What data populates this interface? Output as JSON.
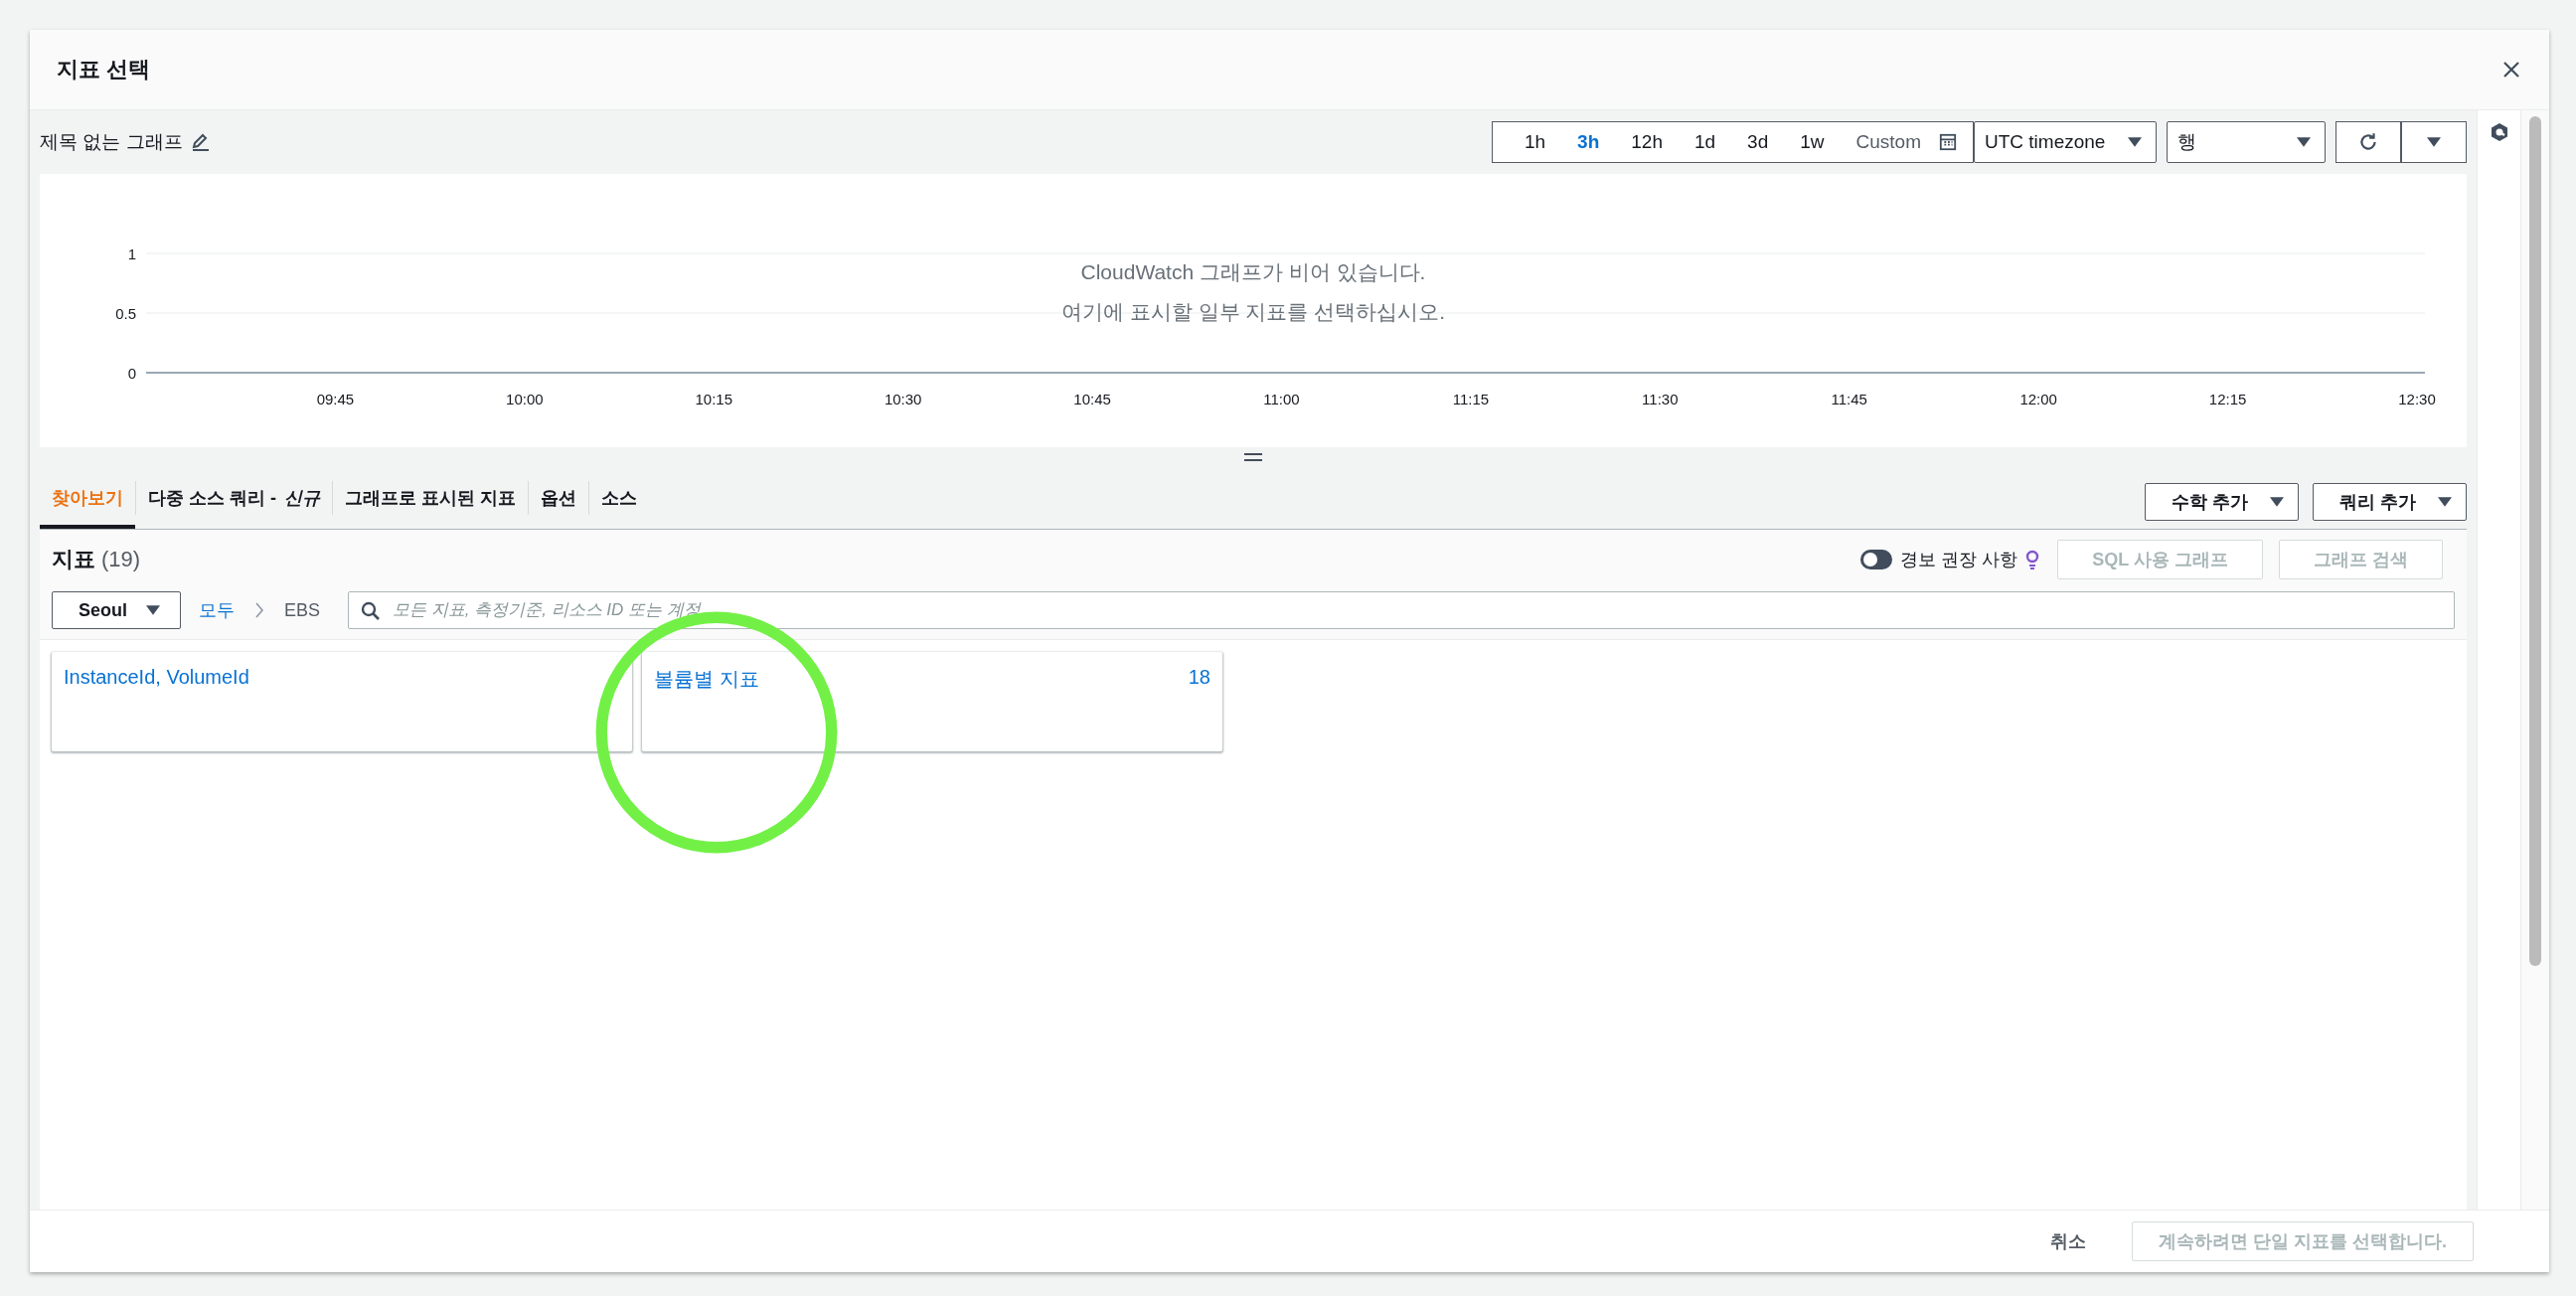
{
  "dialog": {
    "title": "지표 선택"
  },
  "graph": {
    "title": "제목 없는 그래프",
    "time_ranges": [
      {
        "label": "1h",
        "selected": false
      },
      {
        "label": "3h",
        "selected": true
      },
      {
        "label": "12h",
        "selected": false
      },
      {
        "label": "1d",
        "selected": false
      },
      {
        "label": "3d",
        "selected": false
      },
      {
        "label": "1w",
        "selected": false
      }
    ],
    "custom": "Custom",
    "timezone": "UTC timezone",
    "view": "행",
    "chart_data": {
      "type": "line",
      "ylim": [
        0,
        1
      ],
      "yticks": [
        0,
        0.5,
        1
      ],
      "categories": [
        "09:45",
        "10:00",
        "10:15",
        "10:30",
        "10:45",
        "11:00",
        "11:15",
        "11:30",
        "11:45",
        "12:00",
        "12:15",
        "12:30"
      ]
    },
    "empty_message": [
      "CloudWatch 그래프가 비어 있습니다.",
      "여기에 표시할 일부 지표를 선택하십시오."
    ]
  },
  "tabs": [
    {
      "label": "찾아보기",
      "selected": true
    },
    {
      "label": "다중 소스 쿼리 - *신규*",
      "selected": false
    },
    {
      "label": "그래프로 표시된 지표",
      "selected": false
    },
    {
      "label": "옵션",
      "selected": false
    },
    {
      "label": "소스",
      "selected": false
    }
  ],
  "tab_actions": [
    "수학 추가",
    "쿼리 추가"
  ],
  "metrics": {
    "title": "지표",
    "count": "(19)",
    "alarm_toggle": {
      "label": "경보 권장 사항",
      "on": false
    },
    "buttons": [
      {
        "label": "SQL 사용 그래프",
        "disabled": true
      },
      {
        "label": "그래프 검색",
        "disabled": true
      }
    ],
    "region": "Seoul",
    "breadcrumb": [
      "모두",
      "EBS"
    ],
    "search": {
      "placeholder": "모든 지표, 측정기준, 리소스 ID 또는 계정"
    },
    "cards": [
      {
        "title": "InstanceId, VolumeId"
      },
      {
        "title": "볼륨별 지표",
        "count": "18"
      }
    ]
  },
  "footer": {
    "cancel": "취소",
    "confirm": {
      "label": "계속하려면 단일 지표를 선택합니다.",
      "disabled": true
    }
  }
}
